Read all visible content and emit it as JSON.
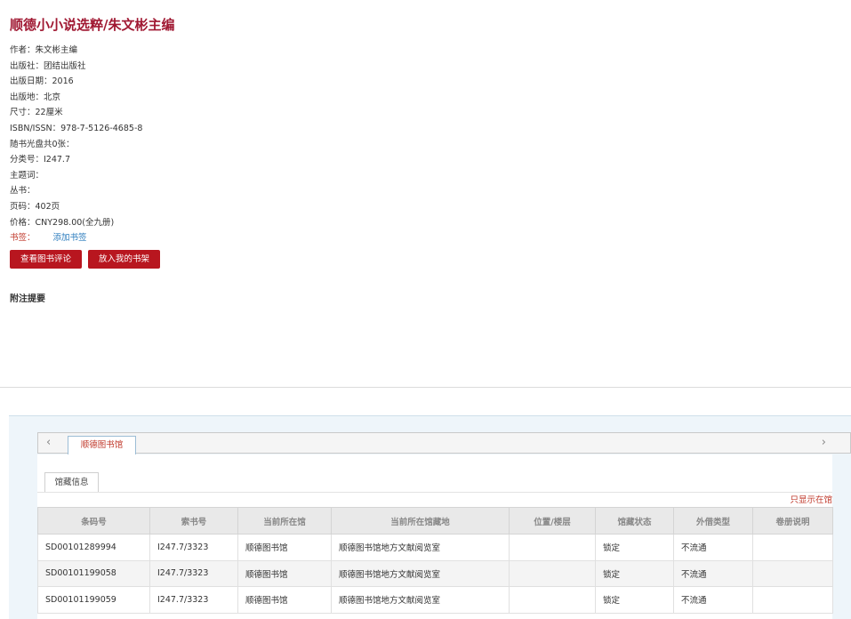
{
  "book": {
    "title": "顺德小小说选粹/朱文彬主编"
  },
  "meta": [
    "作者：朱文彬主编",
    "出版社：团结出版社",
    "出版日期：2016",
    "出版地：北京",
    "尺寸：22厘米",
    "ISBN/ISSN：978-7-5126-4685-8",
    "随书光盘共0张：",
    "分类号：I247.7",
    "主题词：",
    "丛书：",
    "页码：402页",
    "价格：CNY298.00(全九册)"
  ],
  "tags": {
    "label": "书签：",
    "add_link": "添加书签"
  },
  "actions": {
    "review": "查看图书评论",
    "shelf": "放入我的书架"
  },
  "notes": {
    "title": "附注提要"
  },
  "holdings": {
    "library_tab": "顺德图书馆",
    "sub_tab": "馆藏信息",
    "only_show": "只显示在馆",
    "columns": [
      "条码号",
      "索书号",
      "当前所在馆",
      "当前所在馆藏地",
      "位置/楼层",
      "馆藏状态",
      "外借类型",
      "卷册说明"
    ],
    "rows": [
      [
        "SD00101289994",
        "I247.7/3323",
        "顺德图书馆",
        "顺德图书馆地方文献阅览室",
        "",
        "锁定",
        "不流通",
        ""
      ],
      [
        "SD00101199058",
        "I247.7/3323",
        "顺德图书馆",
        "顺德图书馆地方文献阅览室",
        "",
        "锁定",
        "不流通",
        ""
      ],
      [
        "SD00101199059",
        "I247.7/3323",
        "顺德图书馆",
        "顺德图书馆地方文献阅览室",
        "",
        "锁定",
        "不流通",
        ""
      ]
    ]
  },
  "icons": {
    "left": "‹",
    "right": "›"
  }
}
